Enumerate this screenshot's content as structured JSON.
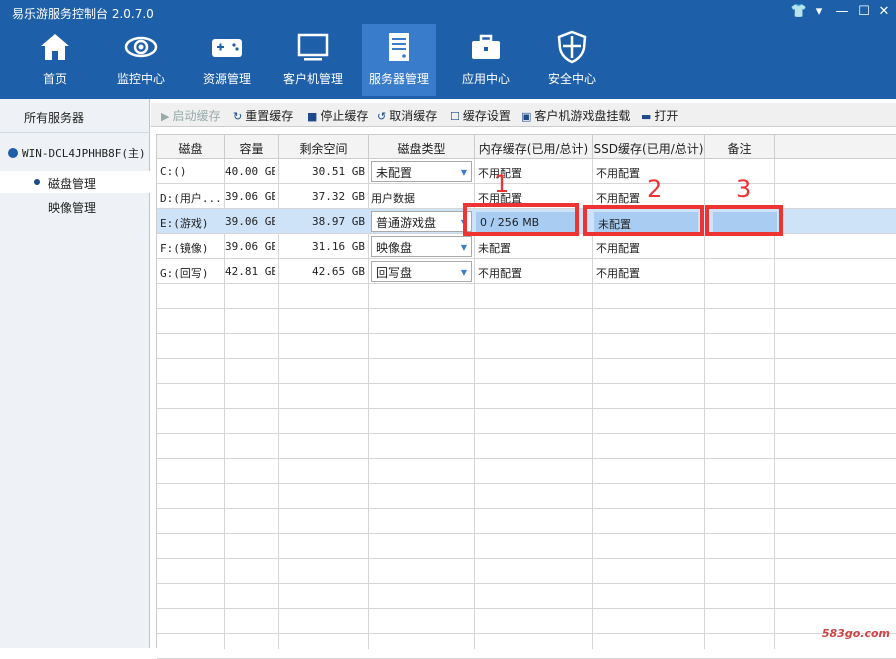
{
  "app": {
    "title": "易乐游服务控制台 2.0.7.0"
  },
  "window_controls": [
    {
      "name": "shirt-icon",
      "glyph": "👕"
    },
    {
      "name": "dropdown-icon",
      "glyph": "▾"
    },
    {
      "name": "minimize-icon",
      "glyph": "—"
    },
    {
      "name": "maximize-icon",
      "glyph": "☐"
    },
    {
      "name": "close-icon",
      "glyph": "✕"
    }
  ],
  "nav": [
    {
      "label": "首页",
      "icon": "home-icon"
    },
    {
      "label": "监控中心",
      "icon": "eye-icon"
    },
    {
      "label": "资源管理",
      "icon": "gamepad-icon"
    },
    {
      "label": "客户机管理",
      "icon": "monitor-icon"
    },
    {
      "label": "服务器管理",
      "icon": "server-icon",
      "active": true
    },
    {
      "label": "应用中心",
      "icon": "toolbox-icon"
    },
    {
      "label": "安全中心",
      "icon": "shield-icon"
    }
  ],
  "sidebar": {
    "all": "所有服务器",
    "server": "WIN-DCL4JPHHB8F(主)",
    "items": [
      {
        "label": "磁盘管理",
        "selected": true
      },
      {
        "label": "映像管理"
      }
    ]
  },
  "toolbar": [
    {
      "label": "启动缓存",
      "icon": "play-icon",
      "glyph": "▶",
      "disabled": true
    },
    {
      "label": "重置缓存",
      "icon": "reset-icon",
      "glyph": "↻"
    },
    {
      "label": "停止缓存",
      "icon": "stop-icon",
      "glyph": "■"
    },
    {
      "label": "取消缓存",
      "icon": "cancel-icon",
      "glyph": "↺"
    },
    {
      "label": "缓存设置",
      "icon": "settings-icon",
      "glyph": "☐"
    },
    {
      "label": "客户机游戏盘挂载",
      "icon": "mount-icon",
      "glyph": "▣"
    },
    {
      "label": "打开",
      "icon": "folder-icon",
      "glyph": "▬"
    }
  ],
  "table": {
    "headers": [
      "磁盘",
      "容量",
      "剩余空间",
      "磁盘类型",
      "内存缓存(已用/总计)",
      "SSD缓存(已用/总计)",
      "备注"
    ],
    "rows": [
      {
        "disk": "C:()",
        "capacity": "40.00 GB",
        "free": "30.51 GB",
        "type": "未配置",
        "type_dropdown": true,
        "mem": "不用配置",
        "ssd": "不用配置",
        "note": ""
      },
      {
        "disk": "D:(用户...",
        "capacity": "39.06 GB",
        "free": "37.32 GB",
        "type": "用户数据",
        "type_dropdown": false,
        "mem": "不用配置",
        "ssd": "不用配置",
        "note": ""
      },
      {
        "disk": "E:(游戏)",
        "capacity": "39.06 GB",
        "free": "38.97 GB",
        "type": "普通游戏盘",
        "type_dropdown": true,
        "mem": "0 / 256 MB",
        "ssd": "未配置",
        "note": "",
        "selected": true
      },
      {
        "disk": "F:(镜像)",
        "capacity": "39.06 GB",
        "free": "31.16 GB",
        "type": "映像盘",
        "type_dropdown": true,
        "mem": "未配置",
        "ssd": "不用配置",
        "note": ""
      },
      {
        "disk": "G:(回写)",
        "capacity": "42.81 GB",
        "free": "42.65 GB",
        "type": "回写盘",
        "type_dropdown": true,
        "mem": "不用配置",
        "ssd": "不用配置",
        "note": ""
      }
    ]
  },
  "annotations": [
    "1",
    "2",
    "3"
  ],
  "watermark": "583go.com"
}
